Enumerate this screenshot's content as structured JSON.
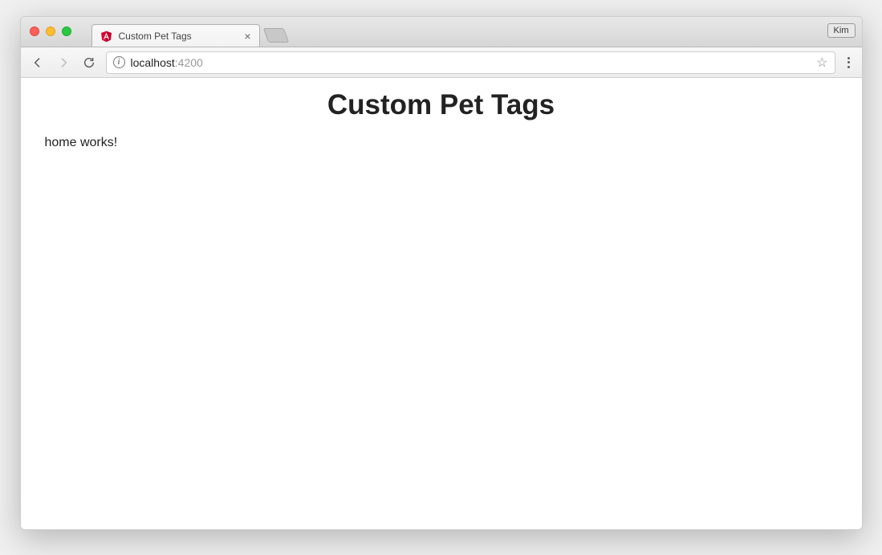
{
  "window": {
    "profile_name": "Kim"
  },
  "tab": {
    "title": "Custom Pet Tags"
  },
  "address_bar": {
    "host": "localhost",
    "port": ":4200"
  },
  "page": {
    "heading": "Custom Pet Tags",
    "body_text": "home works!"
  }
}
